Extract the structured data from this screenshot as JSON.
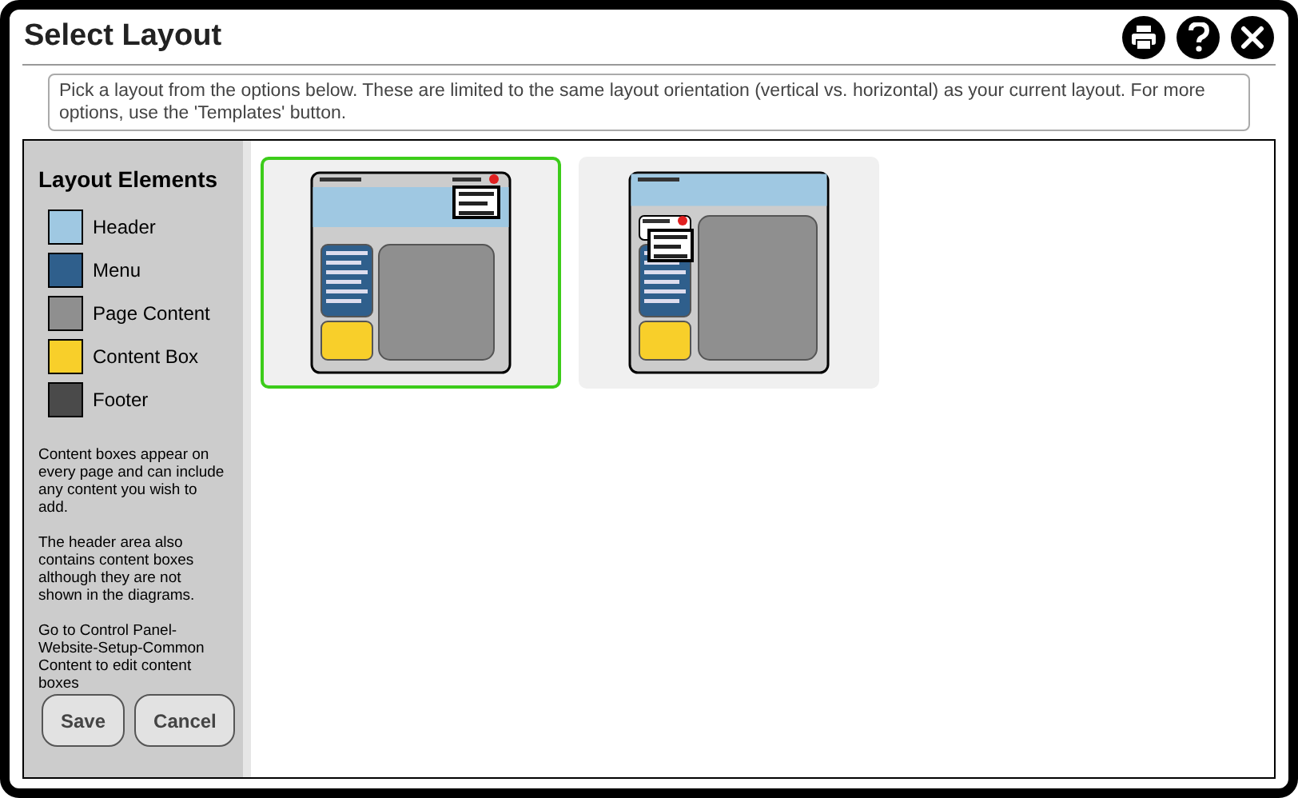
{
  "window": {
    "title": "Select Layout"
  },
  "toolbar": [
    {
      "kind": "print"
    },
    {
      "kind": "help"
    },
    {
      "kind": "close"
    }
  ],
  "instructions": "Pick a layout from the options below. These are limited to the same layout orientation (vertical vs. horizontal) as your current layout. For more options, use the 'Templates' button.",
  "sidebar": {
    "title": "Layout Elements",
    "legend": [
      {
        "label": "Header",
        "color": "#9fc8e2"
      },
      {
        "label": "Menu",
        "color": "#2f5f8c"
      },
      {
        "label": "Page Content",
        "color": "#8f8f8f"
      },
      {
        "label": "Content Box",
        "color": "#f8cf2a"
      },
      {
        "label": "Footer",
        "color": "#4a4a4a"
      }
    ],
    "notes": [
      "Content boxes appear on every page and can include any content you wish to add.",
      "The header area also contains content boxes although they are not shown in the diagrams.",
      "Go to Control Panel-Website-Setup-Common Content to edit content boxes"
    ],
    "buttons": [
      "Save",
      "Cancel"
    ]
  },
  "layouts": [
    {
      "kind": "login-in-header",
      "selected": true
    },
    {
      "kind": "login-in-sidebar",
      "selected": false
    }
  ]
}
